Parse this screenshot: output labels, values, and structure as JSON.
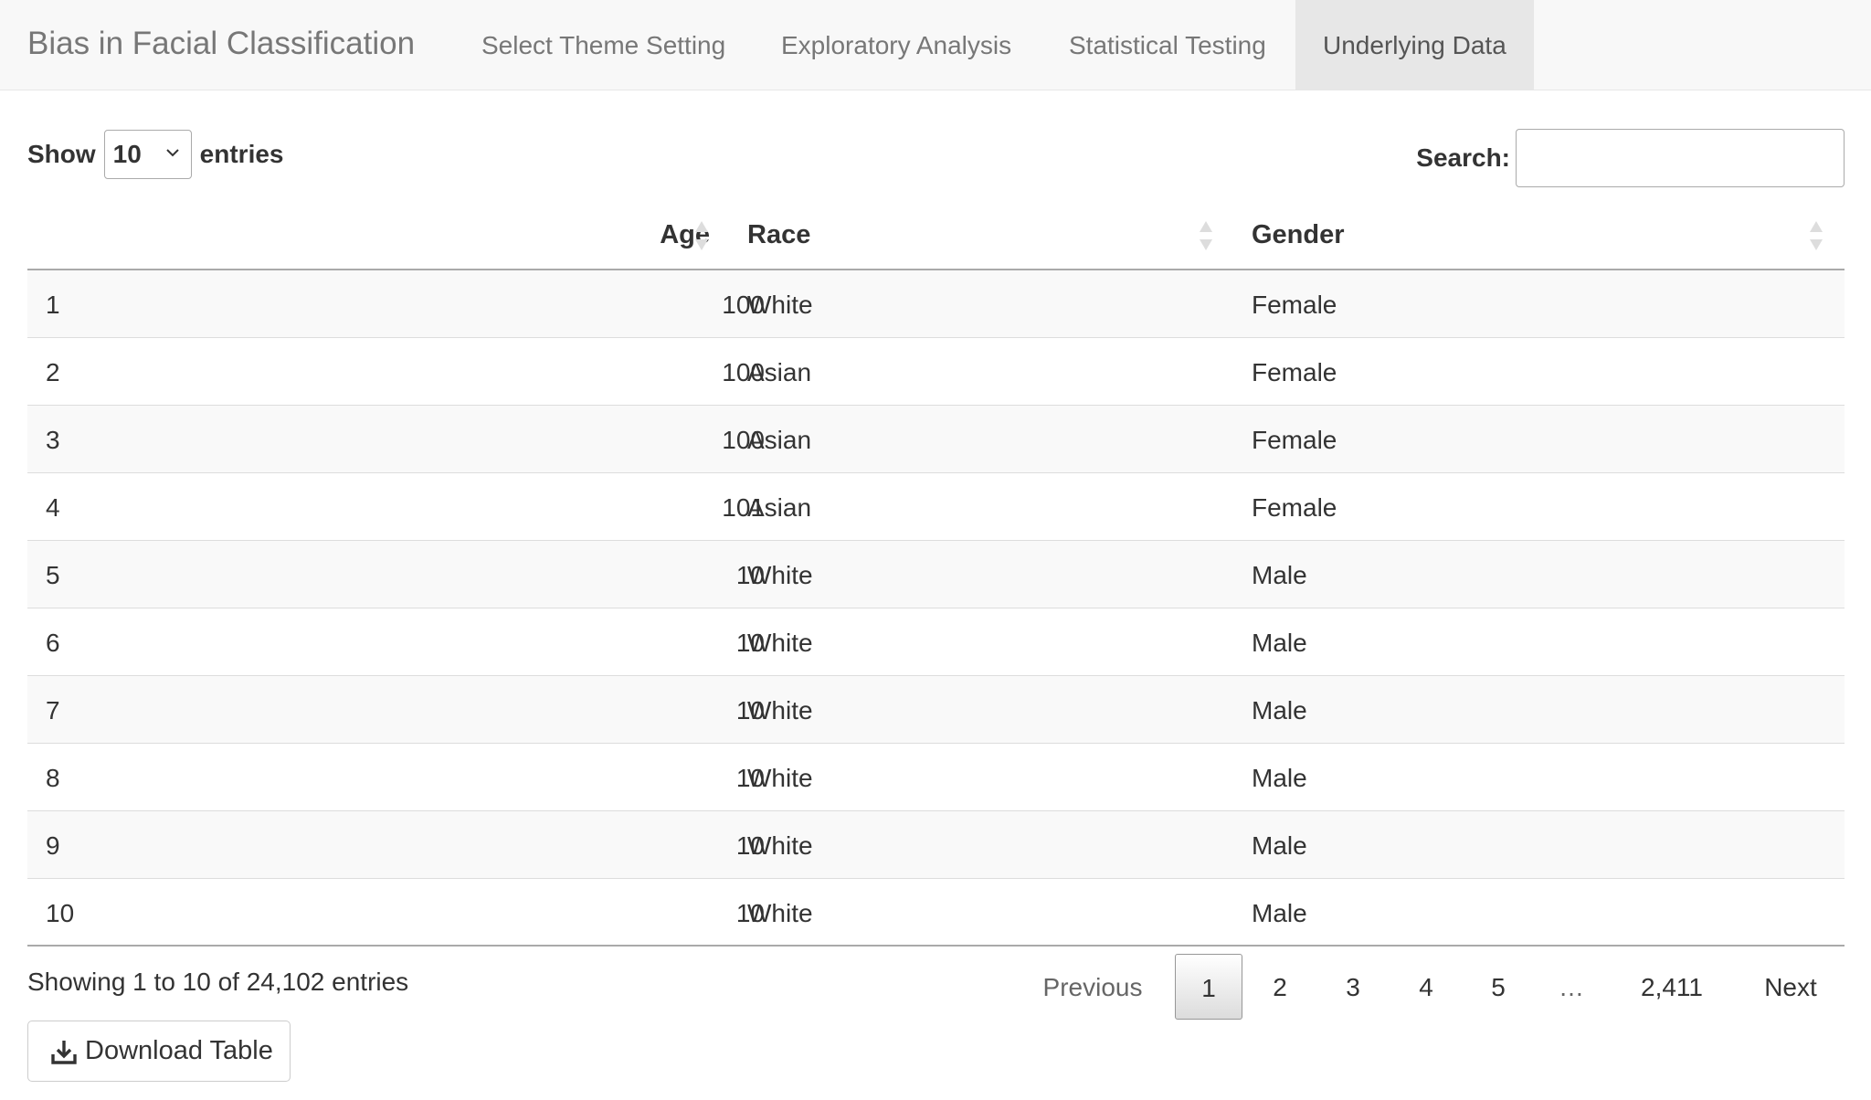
{
  "navbar": {
    "brand": "Bias in Facial Classification",
    "tabs": [
      {
        "label": "Select Theme Setting",
        "active": false
      },
      {
        "label": "Exploratory Analysis",
        "active": false
      },
      {
        "label": "Statistical Testing",
        "active": false
      },
      {
        "label": "Underlying Data",
        "active": true
      }
    ]
  },
  "controls": {
    "show_label": "Show",
    "length_value": "10",
    "entries_label": "entries",
    "search_label": "Search:",
    "search_value": ""
  },
  "table": {
    "columns": [
      "",
      "Age",
      "Race",
      "Gender"
    ],
    "rows": [
      [
        "1",
        "100",
        "White",
        "Female"
      ],
      [
        "2",
        "100",
        "Asian",
        "Female"
      ],
      [
        "3",
        "100",
        "Asian",
        "Female"
      ],
      [
        "4",
        "101",
        "Asian",
        "Female"
      ],
      [
        "5",
        "10",
        "White",
        "Male"
      ],
      [
        "6",
        "10",
        "White",
        "Male"
      ],
      [
        "7",
        "10",
        "White",
        "Male"
      ],
      [
        "8",
        "10",
        "White",
        "Male"
      ],
      [
        "9",
        "10",
        "White",
        "Male"
      ],
      [
        "10",
        "10",
        "White",
        "Male"
      ]
    ]
  },
  "footer": {
    "info": "Showing 1 to 10 of 24,102 entries",
    "pagination": {
      "previous": "Previous",
      "pages": [
        "1",
        "2",
        "3",
        "4",
        "5",
        "…",
        "2,411"
      ],
      "current": "1",
      "next": "Next"
    },
    "download_label": "Download Table"
  },
  "icons": {
    "sort": "sort-both-icon",
    "select_arrow": "chevron-down-icon",
    "download": "download-icon"
  },
  "colors": {
    "navbar_bg": "#f8f8f8",
    "active_tab_bg": "#e7e7e7",
    "striped_row_bg": "#f9f9f9"
  }
}
